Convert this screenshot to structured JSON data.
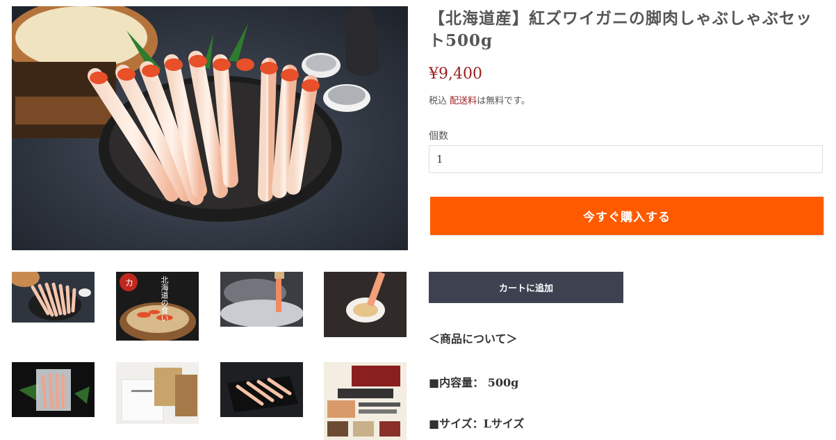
{
  "product": {
    "title": "【北海道産】紅ズワイガニの脚肉しゃぶしゃぶセット500g",
    "price": "¥9,400",
    "tax_prefix": "税込 ",
    "shipping_link": "配送料",
    "shipping_suffix": "は無料です。",
    "quantity_label": "個数",
    "quantity_value": "1"
  },
  "buttons": {
    "buy_now": "今すぐ購入する",
    "add_to_cart": "カートに追加"
  },
  "description": {
    "heading": "＜商品について＞",
    "capacity": "■内容量： 500g",
    "size": "■サイズ：Lサイズ"
  },
  "gallery": {
    "thumb2_text": "北海道の食い"
  },
  "colors": {
    "accent_buy": "#ff5a00",
    "cart_button": "#3d4150",
    "price": "#9b2020"
  }
}
